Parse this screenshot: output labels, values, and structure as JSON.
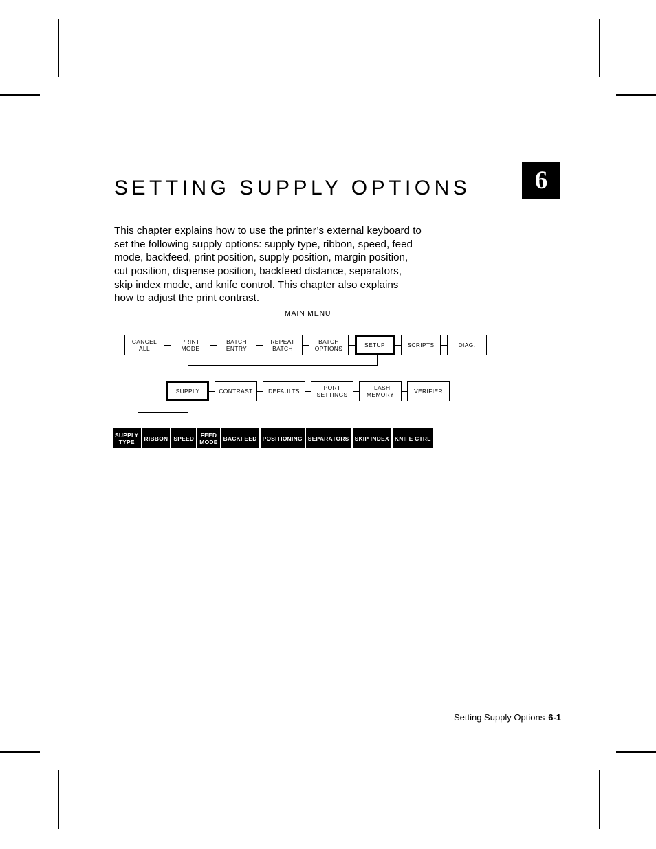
{
  "chapter": {
    "title": "SETTING SUPPLY OPTIONS",
    "number": "6"
  },
  "intro": {
    "paragraph": "This chapter explains how to use the printer’s external keyboard to\nset the following supply options:  supply type, ribbon, speed, feed\nmode, backfeed, print position, supply position, margin position,\ncut position, dispense position, backfeed distance, separators,\nskip index mode, and knife control.  This chapter also explains\nhow to adjust the print contrast."
  },
  "diagram": {
    "caption": "MAIN MENU",
    "rows": [
      {
        "name": "main-menu-row",
        "style": "outline",
        "items": [
          {
            "label": "CANCEL\nALL",
            "highlighted": false
          },
          {
            "label": "PRINT\nMODE",
            "highlighted": false
          },
          {
            "label": "BATCH\nENTRY",
            "highlighted": false
          },
          {
            "label": "REPEAT\nBATCH",
            "highlighted": false
          },
          {
            "label": "BATCH\nOPTIONS",
            "highlighted": false
          },
          {
            "label": "SETUP",
            "highlighted": true
          },
          {
            "label": "SCRIPTS",
            "highlighted": false
          },
          {
            "label": "DIAG.",
            "highlighted": false
          }
        ]
      },
      {
        "name": "setup-menu-row",
        "style": "outline",
        "items": [
          {
            "label": "SUPPLY",
            "highlighted": true
          },
          {
            "label": "CONTRAST",
            "highlighted": false
          },
          {
            "label": "DEFAULTS",
            "highlighted": false
          },
          {
            "label": "PORT\nSETTINGS",
            "highlighted": false
          },
          {
            "label": "FLASH\nMEMORY",
            "highlighted": false
          },
          {
            "label": "VERIFIER",
            "highlighted": false
          }
        ]
      },
      {
        "name": "supply-menu-row",
        "style": "inverted",
        "items": [
          {
            "label": "SUPPLY\nTYPE",
            "highlighted": false
          },
          {
            "label": "RIBBON",
            "highlighted": false
          },
          {
            "label": "SPEED",
            "highlighted": false
          },
          {
            "label": "FEED\nMODE",
            "highlighted": false
          },
          {
            "label": "BACKFEED",
            "highlighted": false
          },
          {
            "label": "POSITIONING",
            "highlighted": false
          },
          {
            "label": "SEPARATORS",
            "highlighted": false
          },
          {
            "label": "SKIP INDEX",
            "highlighted": false
          },
          {
            "label": "KNIFE CTRL",
            "highlighted": false
          }
        ]
      }
    ]
  },
  "footer": {
    "chapter_name": "Setting Supply Options",
    "page_number": "6-1"
  },
  "colors": {
    "ink": "#000000",
    "paper": "#ffffff",
    "inverted_text": "#ffffff"
  }
}
